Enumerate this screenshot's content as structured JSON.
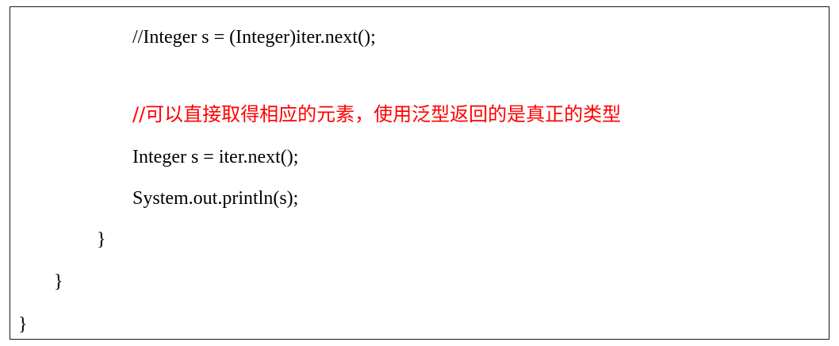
{
  "code_lines": [
    "//Integer s = (Integer)iter.next();",
    "//可以直接取得相应的元素，使用泛型返回的是真正的类型",
    "Integer s = iter.next();",
    "System.out.println(s);",
    "}",
    "}",
    "}"
  ],
  "colors": {
    "comment_highlight": "#ff0000",
    "code_text": "#000000",
    "border": "#1a1a1a"
  }
}
